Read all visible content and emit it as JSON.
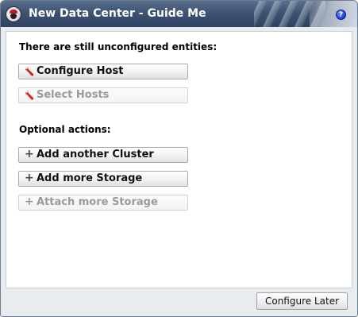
{
  "window": {
    "title": "New Data Center - Guide Me",
    "help_symbol": "?"
  },
  "unconfigured": {
    "heading": "There are still unconfigured entities:",
    "buttons": [
      {
        "label": "Configure Host",
        "icon": "wrench-icon",
        "enabled": true
      },
      {
        "label": "Select Hosts",
        "icon": "wrench-icon",
        "enabled": false
      }
    ]
  },
  "optional": {
    "heading": "Optional actions:",
    "buttons": [
      {
        "label": "Add another Cluster",
        "icon": "plus-icon",
        "enabled": true
      },
      {
        "label": "Add more Storage",
        "icon": "plus-icon",
        "enabled": true
      },
      {
        "label": "Attach more Storage",
        "icon": "plus-icon",
        "enabled": false
      }
    ]
  },
  "footer": {
    "configure_later_label": "Configure Later"
  },
  "colors": {
    "titlebar": "#3e5372",
    "wrench": "#d2261c",
    "help_icon": "#1b3fd6"
  }
}
